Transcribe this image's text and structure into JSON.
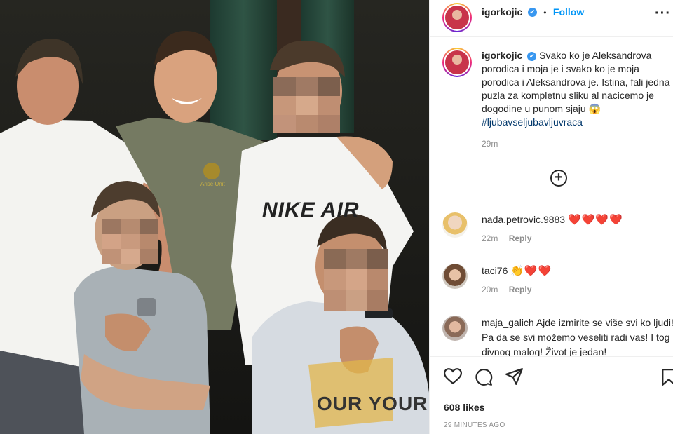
{
  "photo": {
    "shirt_text": "NIKE AIR",
    "shirt2_text": "OUR YOUR",
    "badge_text": "Arise Unit"
  },
  "header": {
    "username": "igorkojic",
    "verified_mark": "✔",
    "separator": "•",
    "follow_label": "Follow",
    "more_label": "···"
  },
  "caption": {
    "username": "igorkojic",
    "verified_mark": "✔",
    "text": "Svako ko je Aleksandrova porodica i moja je i svako ko je moja porodica i Aleksandrova je. Istina, fali jedna puzla za kompletnu sliku al nacicemo je dogodine u punom sjaju",
    "emoji": "😱",
    "hashtag": "#ljubavseljubavljuvraca",
    "time": "29m"
  },
  "load_more_label": "+",
  "comments": [
    {
      "username": "nada.petrovic.9883",
      "text": "❤️❤️❤️❤️",
      "time": "22m",
      "reply_label": "Reply"
    },
    {
      "username": "taci76",
      "text": "👏❤️❤️",
      "time": "20m",
      "reply_label": "Reply"
    },
    {
      "username": "maja_galich",
      "text": "Ajde izmirite se više svi ko ljudi! Pa da se svi možemo veseliti radi vas! I tog divnog malog! Život je jedan!"
    }
  ],
  "actions": {
    "likes": "608 likes",
    "posted": "29 MINUTES AGO"
  },
  "colors": {
    "accent": "#0095f6",
    "heart": "#e0161b",
    "muted": "#8e8e8e",
    "text": "#262626"
  }
}
